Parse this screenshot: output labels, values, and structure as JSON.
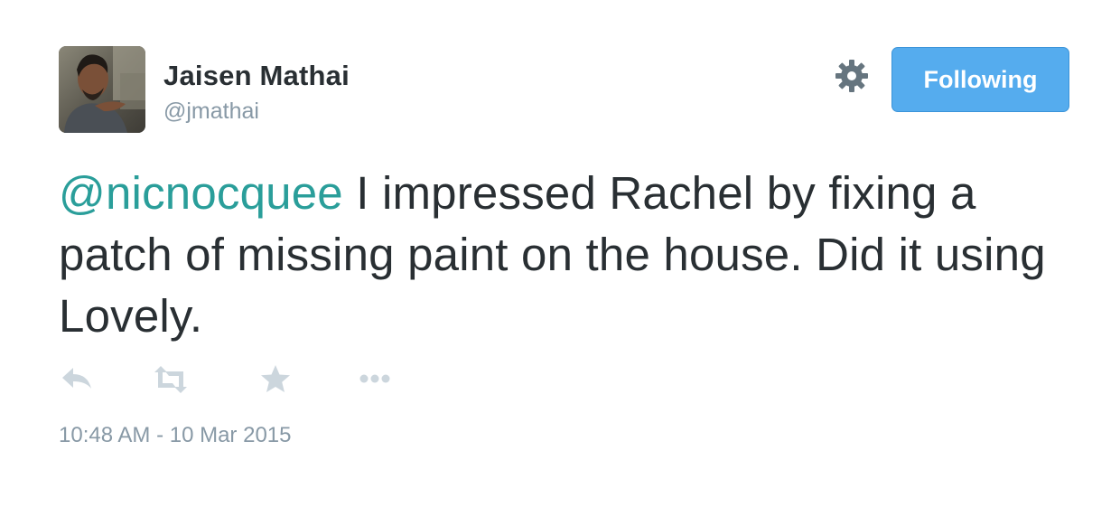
{
  "user": {
    "display_name": "Jaisen Mathai",
    "screen_name": "@jmathai"
  },
  "follow_button": {
    "label": "Following",
    "color": "#55acee"
  },
  "settings": {
    "icon": "gear-icon"
  },
  "tweet": {
    "mention": "@nicnocquee",
    "text": " I impressed Rachel by fixing a patch of missing paint on the house. Did it using Lovely.",
    "timestamp": "10:48 AM - 10 Mar 2015",
    "mention_color": "#2a9e9a"
  },
  "actions": [
    {
      "name": "reply",
      "icon": "reply-icon"
    },
    {
      "name": "retweet",
      "icon": "retweet-icon"
    },
    {
      "name": "favorite",
      "icon": "star-icon"
    },
    {
      "name": "more",
      "icon": "more-icon"
    }
  ]
}
